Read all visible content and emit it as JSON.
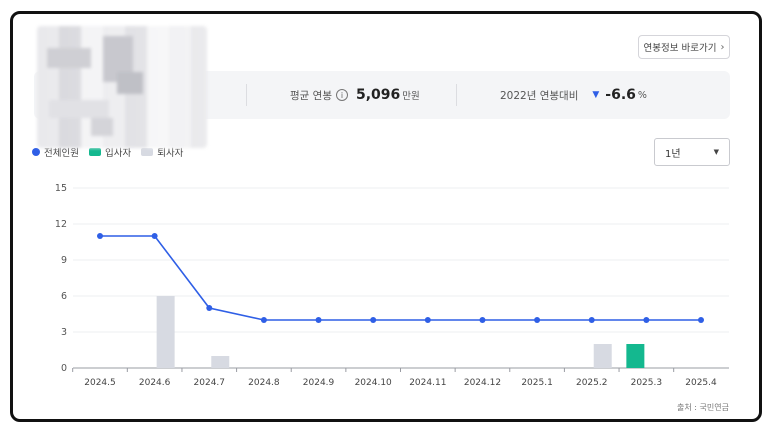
{
  "link_button": {
    "label": "연봉정보 바로가기",
    "chevron_icon": "chevron-right-icon"
  },
  "summary": {
    "employees": {
      "value_suffix": "4 명"
    },
    "avg_salary": {
      "label": "평균 연봉",
      "value": "5,096",
      "unit": "만원",
      "icon": "info-icon"
    },
    "yoy": {
      "label": "2022년 연봉대비",
      "value": "-6.6",
      "unit": "%",
      "icon": "triangle-down-icon"
    }
  },
  "period_select": {
    "value": "1년"
  },
  "source_note": "출처 : 국민연금",
  "colors": {
    "total": "#2f5fe6",
    "hired": "#14b88f",
    "left": "#d7dae2",
    "accent": "#2f5fe6"
  },
  "chart_data": {
    "type": "line",
    "categories": [
      "2024.5",
      "2024.6",
      "2024.7",
      "2024.8",
      "2024.9",
      "2024.10",
      "2024.11",
      "2024.12",
      "2025.1",
      "2025.2",
      "2025.3",
      "2025.4"
    ],
    "ylim": [
      0,
      15
    ],
    "yticks": [
      0,
      3,
      6,
      9,
      12,
      15
    ],
    "legend_position": "top-left",
    "grid": true,
    "series": [
      {
        "name": "전체인원",
        "kind": "line",
        "color": "#2f5fe6",
        "values": [
          11,
          11,
          5,
          4,
          4,
          4,
          4,
          4,
          4,
          4,
          4,
          4
        ]
      },
      {
        "name": "입사자",
        "kind": "bar",
        "color": "#14b88f",
        "values": [
          0,
          0,
          0,
          0,
          0,
          0,
          0,
          0,
          0,
          0,
          2,
          0
        ]
      },
      {
        "name": "퇴사자",
        "kind": "bar",
        "color": "#d7dae2",
        "values": [
          0,
          6,
          1,
          0,
          0,
          0,
          0,
          0,
          0,
          2,
          0,
          0
        ]
      }
    ]
  }
}
